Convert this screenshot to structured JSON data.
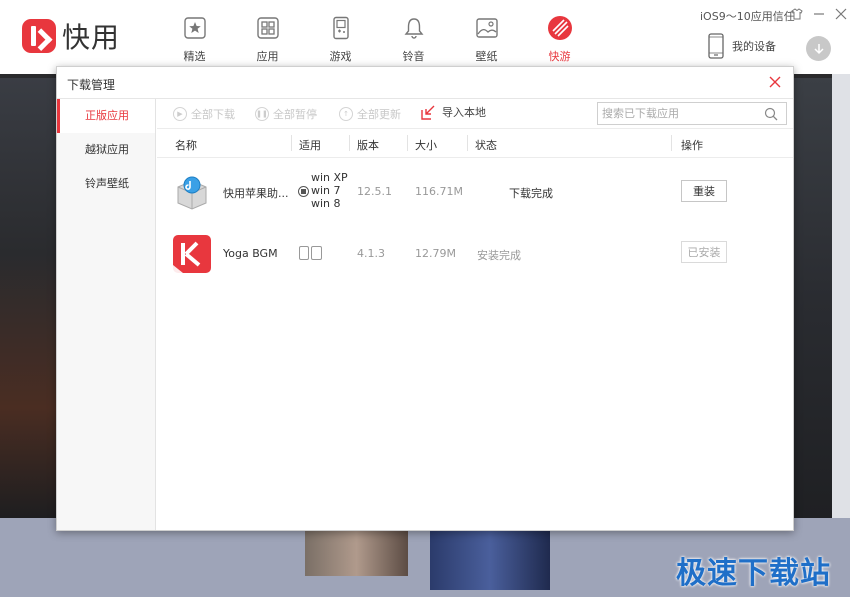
{
  "app": {
    "logo_text": "快用"
  },
  "nav": [
    {
      "label": "精选",
      "icon": "featured-star-icon"
    },
    {
      "label": "应用",
      "icon": "apps-grid-icon"
    },
    {
      "label": "游戏",
      "icon": "gamepad-icon"
    },
    {
      "label": "铃音",
      "icon": "bell-icon"
    },
    {
      "label": "壁纸",
      "icon": "wallpaper-icon"
    },
    {
      "label": "快游",
      "icon": "kuaiyou-icon"
    }
  ],
  "header": {
    "trust_text": "iOS9～10应用信任",
    "device_label": "我的设备"
  },
  "colors": {
    "accent": "#e8373e",
    "watermark": "#1f6fc8"
  },
  "watermark": "极速下载站",
  "dialog": {
    "title": "下载管理",
    "sidebar": [
      {
        "label": "正版应用"
      },
      {
        "label": "越狱应用"
      },
      {
        "label": "铃声壁纸"
      }
    ],
    "toolbar": {
      "download_all": "全部下载",
      "pause_all": "全部暂停",
      "update_all": "全部更新",
      "import_local": "导入本地",
      "search_placeholder": "搜索已下载应用"
    },
    "columns": {
      "name": "名称",
      "compat": "适用",
      "version": "版本",
      "size": "大小",
      "status": "状态",
      "action": "操作"
    },
    "rows": [
      {
        "name": "快用苹果助...",
        "compat": [
          "win XP",
          "win 7",
          "win 8"
        ],
        "version": "12.5.1",
        "size": "116.71M",
        "status": "下载完成",
        "action": "重装"
      },
      {
        "name": "Yoga BGM",
        "compat": [],
        "version": "4.1.3",
        "size": "12.79M",
        "status": "安装完成",
        "action": "已安装"
      }
    ]
  }
}
